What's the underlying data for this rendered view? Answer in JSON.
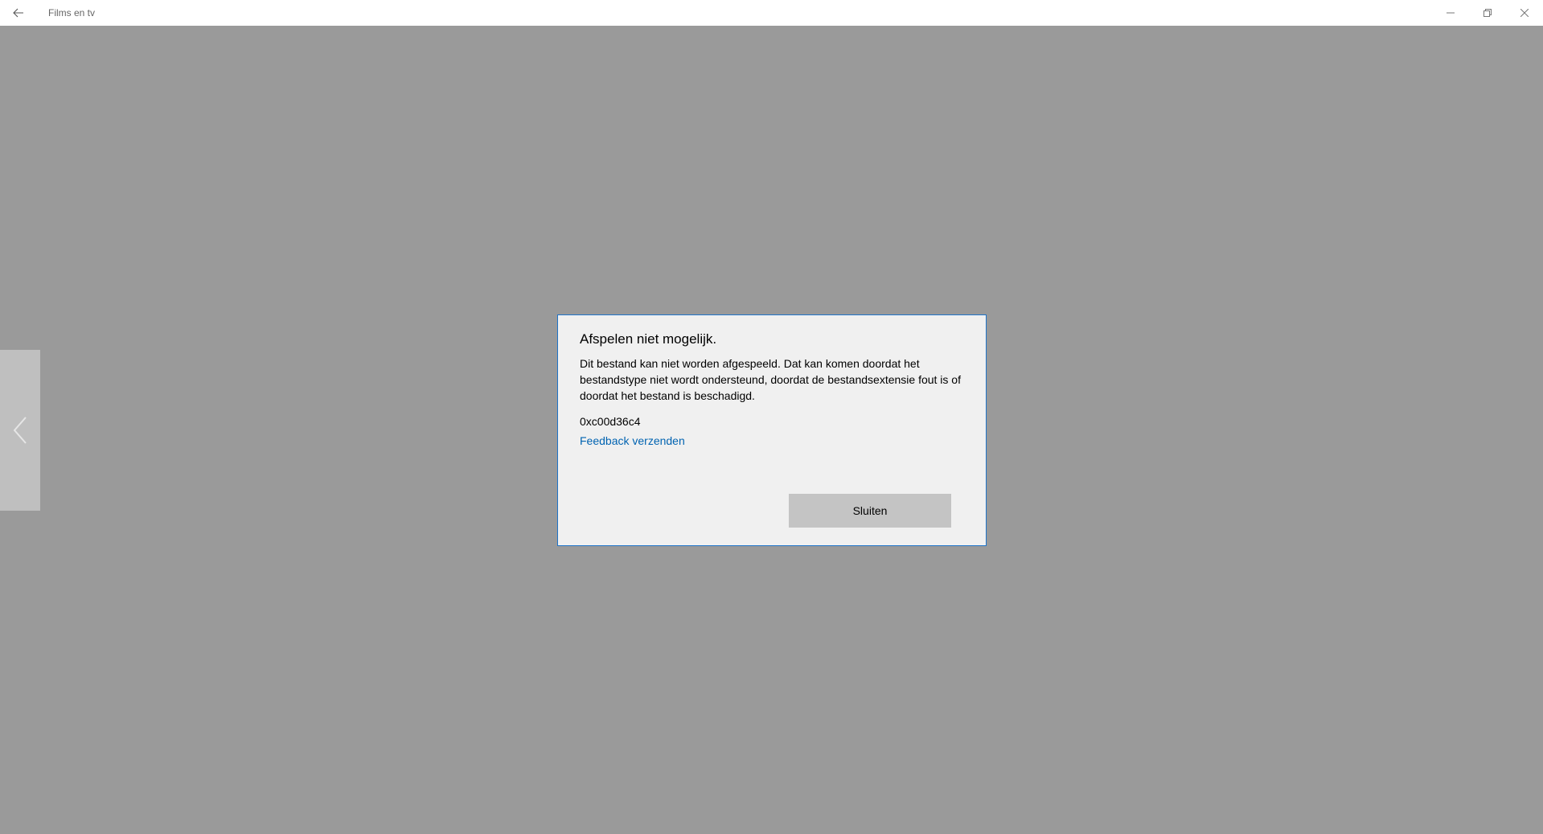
{
  "window": {
    "title": "Films en tv"
  },
  "titlebar": {
    "back_icon": "arrow-left-icon",
    "minimize_icon": "minimize-icon",
    "restore_icon": "restore-icon",
    "close_icon": "close-icon"
  },
  "player": {
    "prev_icon": "chevron-left-icon"
  },
  "dialog": {
    "title": "Afspelen niet mogelijk.",
    "message": "Dit bestand kan niet worden afgespeeld. Dat kan komen doordat het bestandstype niet wordt ondersteund, doordat de bestandsextensie fout is of doordat het bestand is beschadigd.",
    "error_code": "0xc00d36c4",
    "feedback_link": "Feedback verzenden",
    "close_button": "Sluiten"
  },
  "colors": {
    "background": "#9a9a9a",
    "dialog_bg": "#f0f0f0",
    "dialog_border": "#1e73c8",
    "link": "#0063b1",
    "button_bg": "#c4c4c4"
  }
}
